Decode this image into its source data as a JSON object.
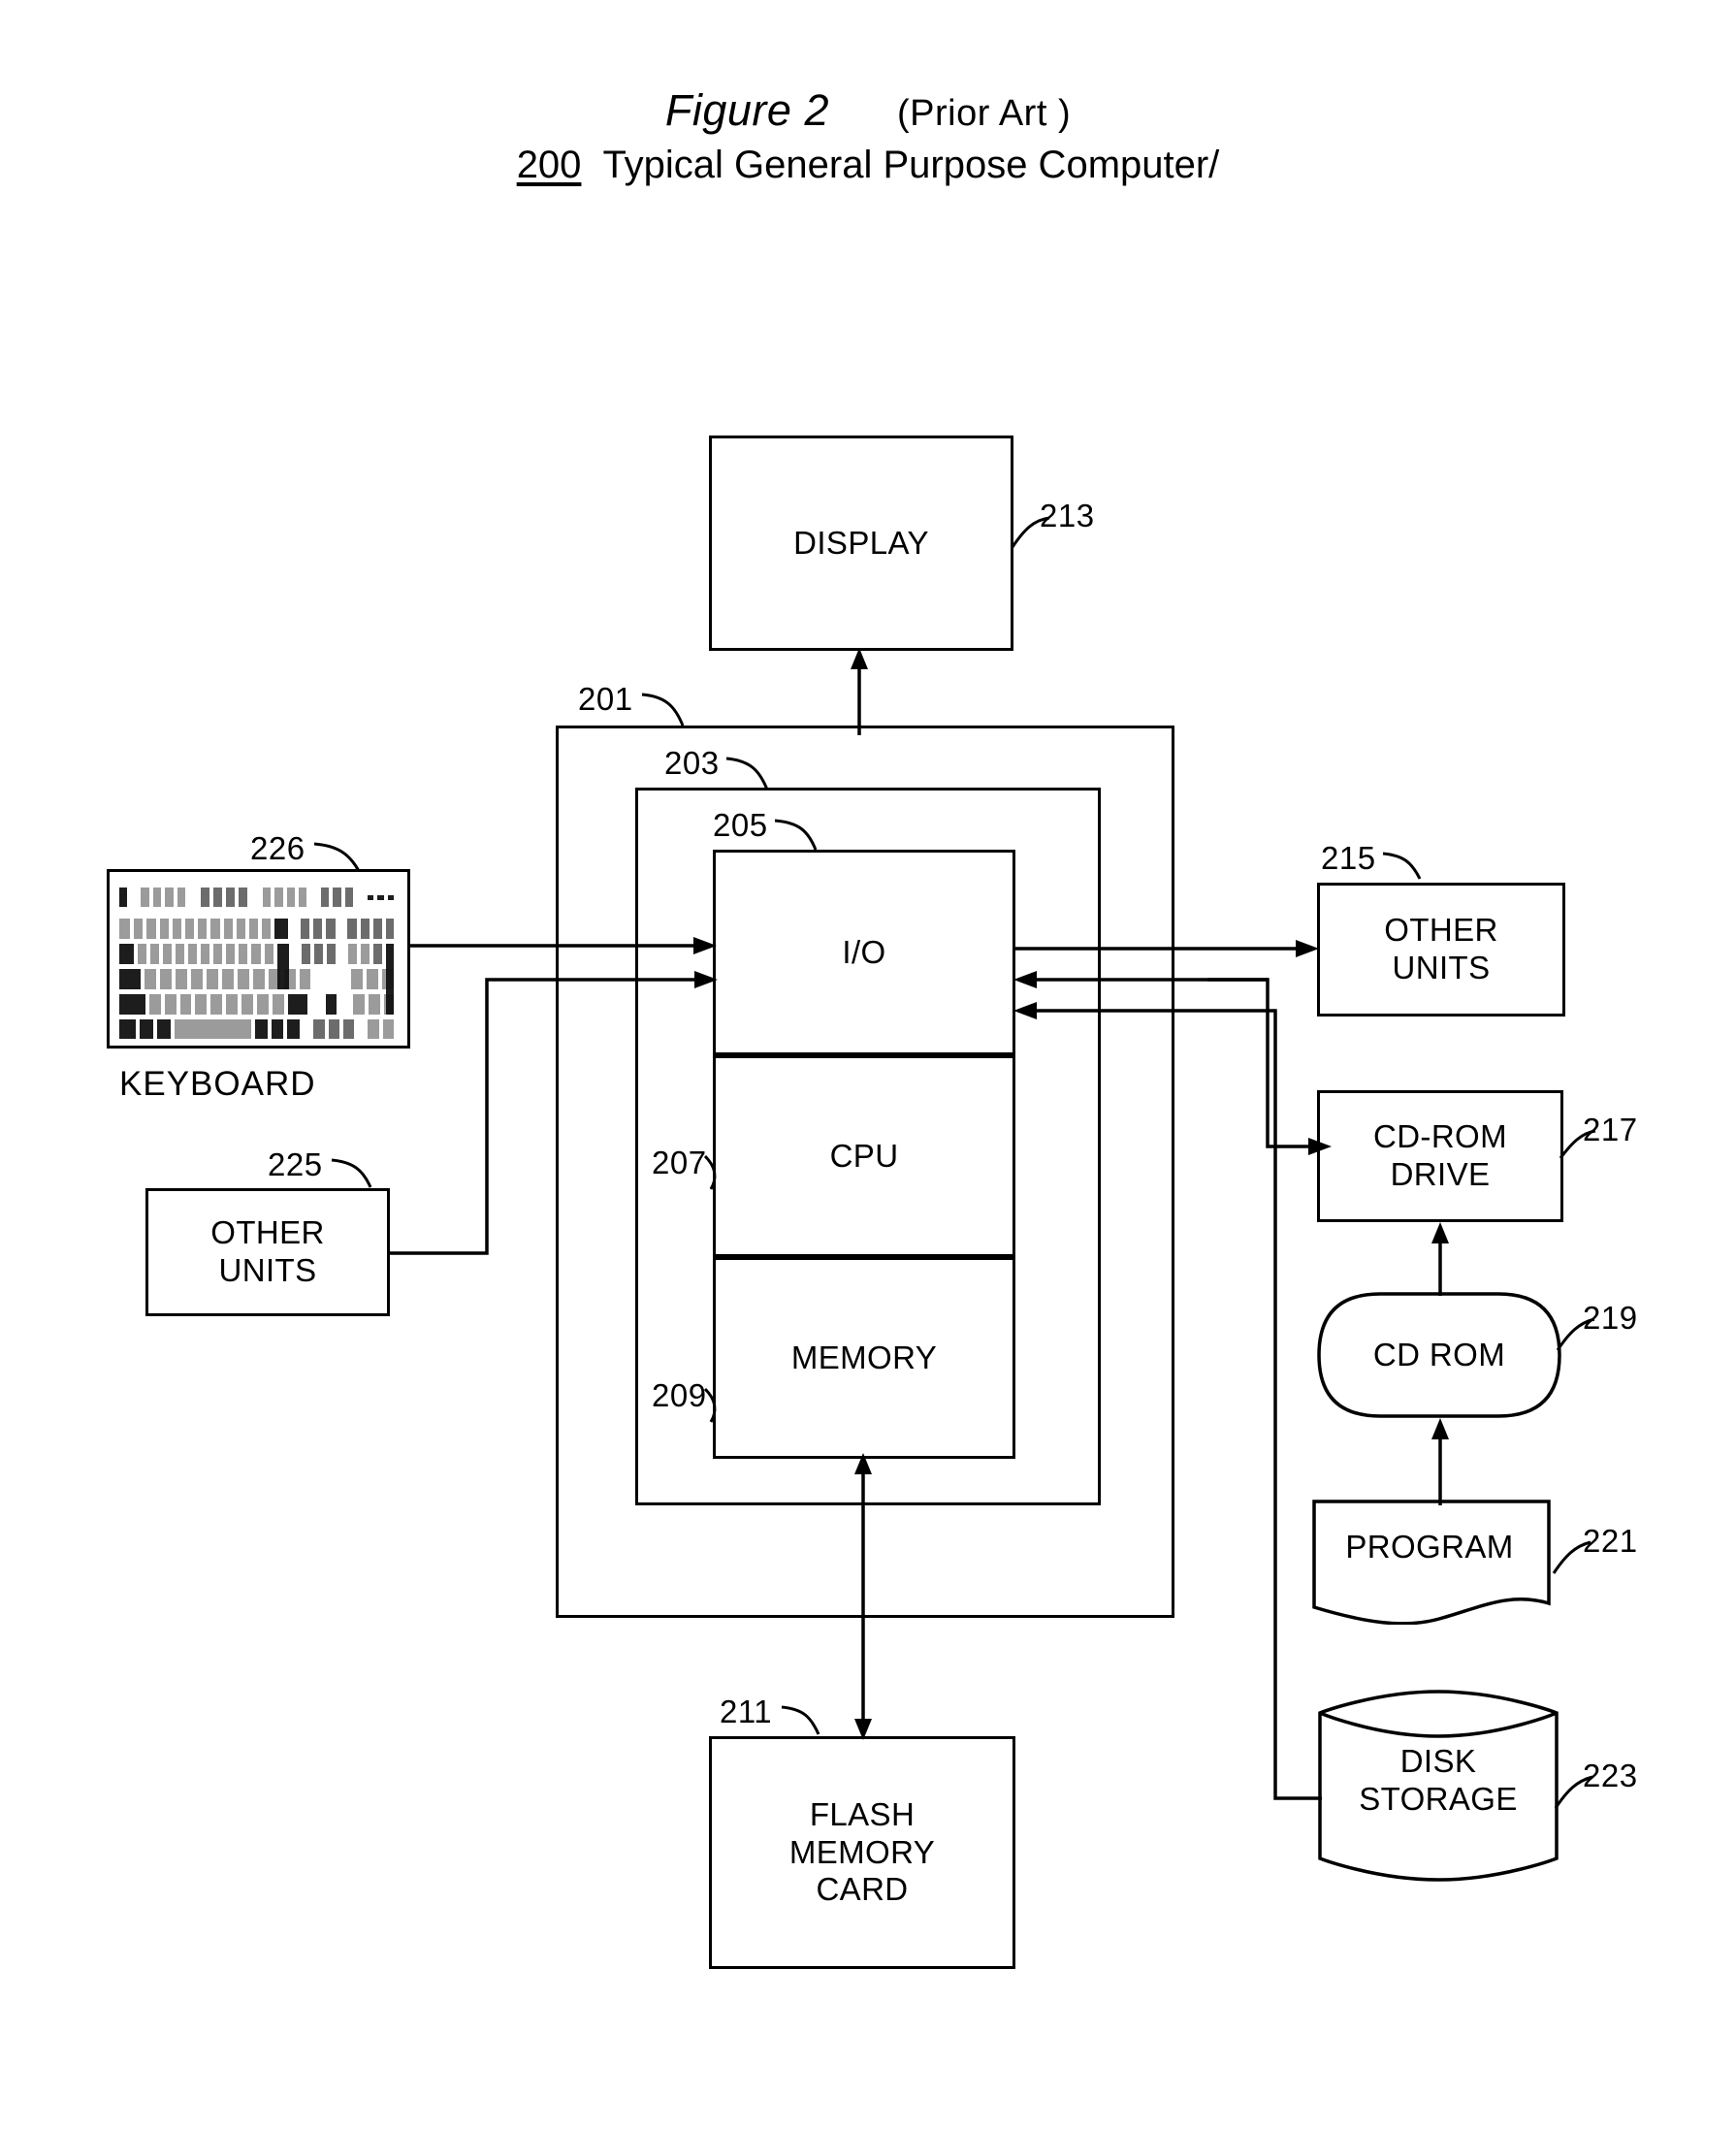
{
  "figure": {
    "label": "Figure 2",
    "prior_art": "(Prior Art )",
    "ref": "200",
    "subtitle": "Typical General Purpose Computer/"
  },
  "nodes": {
    "display": {
      "label": "DISPLAY",
      "ref": "213"
    },
    "io": {
      "label": "I/O",
      "ref": "205"
    },
    "cpu": {
      "label": "CPU",
      "ref": "207"
    },
    "memory": {
      "label": "MEMORY",
      "ref": "209"
    },
    "outer_frame": {
      "ref": "201"
    },
    "inner_frame": {
      "ref": "203"
    },
    "keyboard": {
      "label": "KEYBOARD",
      "ref": "226"
    },
    "other_units_left": {
      "line1": "OTHER",
      "line2": "UNITS",
      "ref": "225"
    },
    "other_units_right": {
      "line1": "OTHER",
      "line2": "UNITS",
      "ref": "215"
    },
    "cdrom_drive": {
      "line1": "CD-ROM",
      "line2": "DRIVE",
      "ref": "217"
    },
    "cdrom": {
      "label": "CD ROM",
      "ref": "219"
    },
    "program": {
      "label": "PROGRAM",
      "ref": "221"
    },
    "disk_storage": {
      "line1": "DISK",
      "line2": "STORAGE",
      "ref": "223"
    },
    "flash_card": {
      "line1": "FLASH",
      "line2": "MEMORY",
      "line3": "CARD",
      "ref": "211"
    }
  },
  "colors": {
    "ink": "#000000",
    "paper": "#ffffff"
  }
}
